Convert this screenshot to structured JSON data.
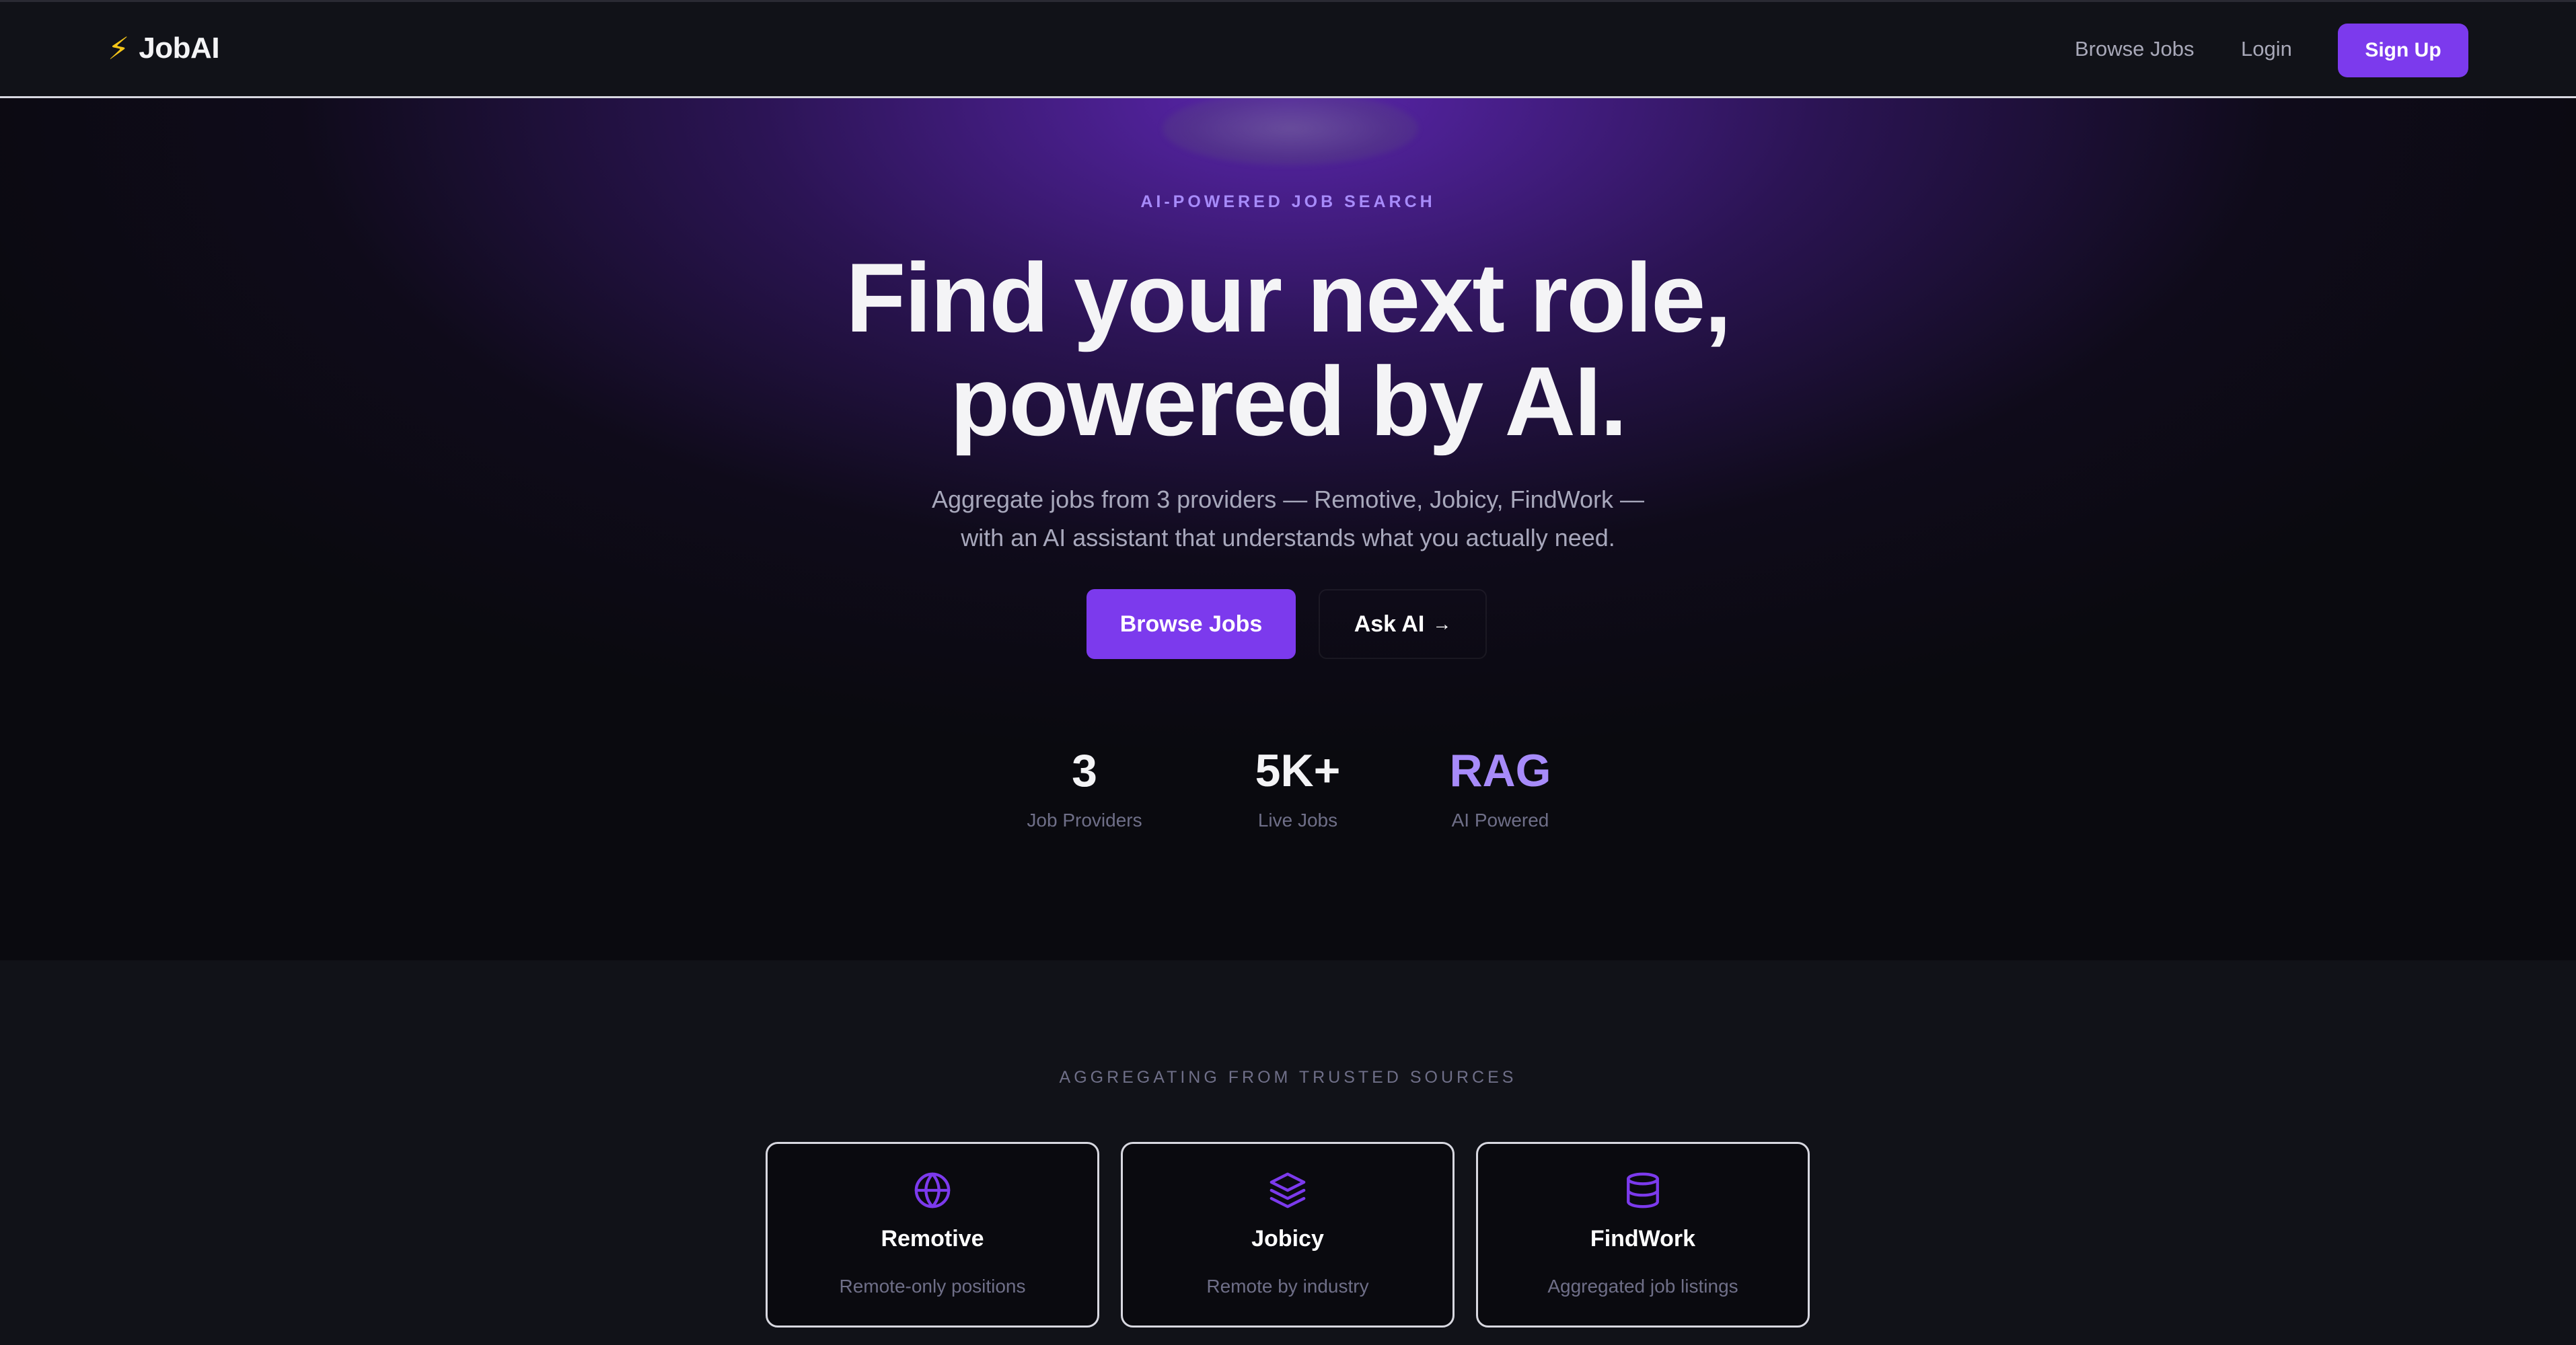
{
  "nav": {
    "brand_icon": "lightning-bolt-icon",
    "brand_icon_glyph": "⚡",
    "brand_name": "JobAI",
    "browse_label": "Browse Jobs",
    "login_label": "Login",
    "signup_label": "Sign Up"
  },
  "hero": {
    "eyebrow": "AI-POWERED JOB SEARCH",
    "title_line1": "Find your next role,",
    "title_line2": "powered by AI.",
    "subtitle_line1": "Aggregate jobs from 3 providers — Remotive, Jobicy, FindWork —",
    "subtitle_line2": "with an AI assistant that understands what you actually need.",
    "primary_cta": "Browse Jobs",
    "secondary_cta": "Ask AI",
    "secondary_cta_arrow": "→",
    "stats": [
      {
        "value": "3",
        "label": "Job Providers"
      },
      {
        "value": "5K+",
        "label": "Live Jobs"
      },
      {
        "value": "RAG",
        "label": "AI Powered"
      }
    ]
  },
  "sources": {
    "eyebrow": "AGGREGATING FROM TRUSTED SOURCES",
    "cards": [
      {
        "icon": "globe-icon",
        "title": "Remotive",
        "description": "Remote-only positions"
      },
      {
        "icon": "layers-icon",
        "title": "Jobicy",
        "description": "Remote by industry"
      },
      {
        "icon": "database-icon",
        "title": "FindWork",
        "description": "Aggregated job listings"
      }
    ]
  },
  "colors": {
    "accent": "#7c3aed",
    "accent_light": "#a78bfa",
    "background": "#0a0a0f",
    "surface": "#111218",
    "brand_bolt": "#f5c518"
  }
}
